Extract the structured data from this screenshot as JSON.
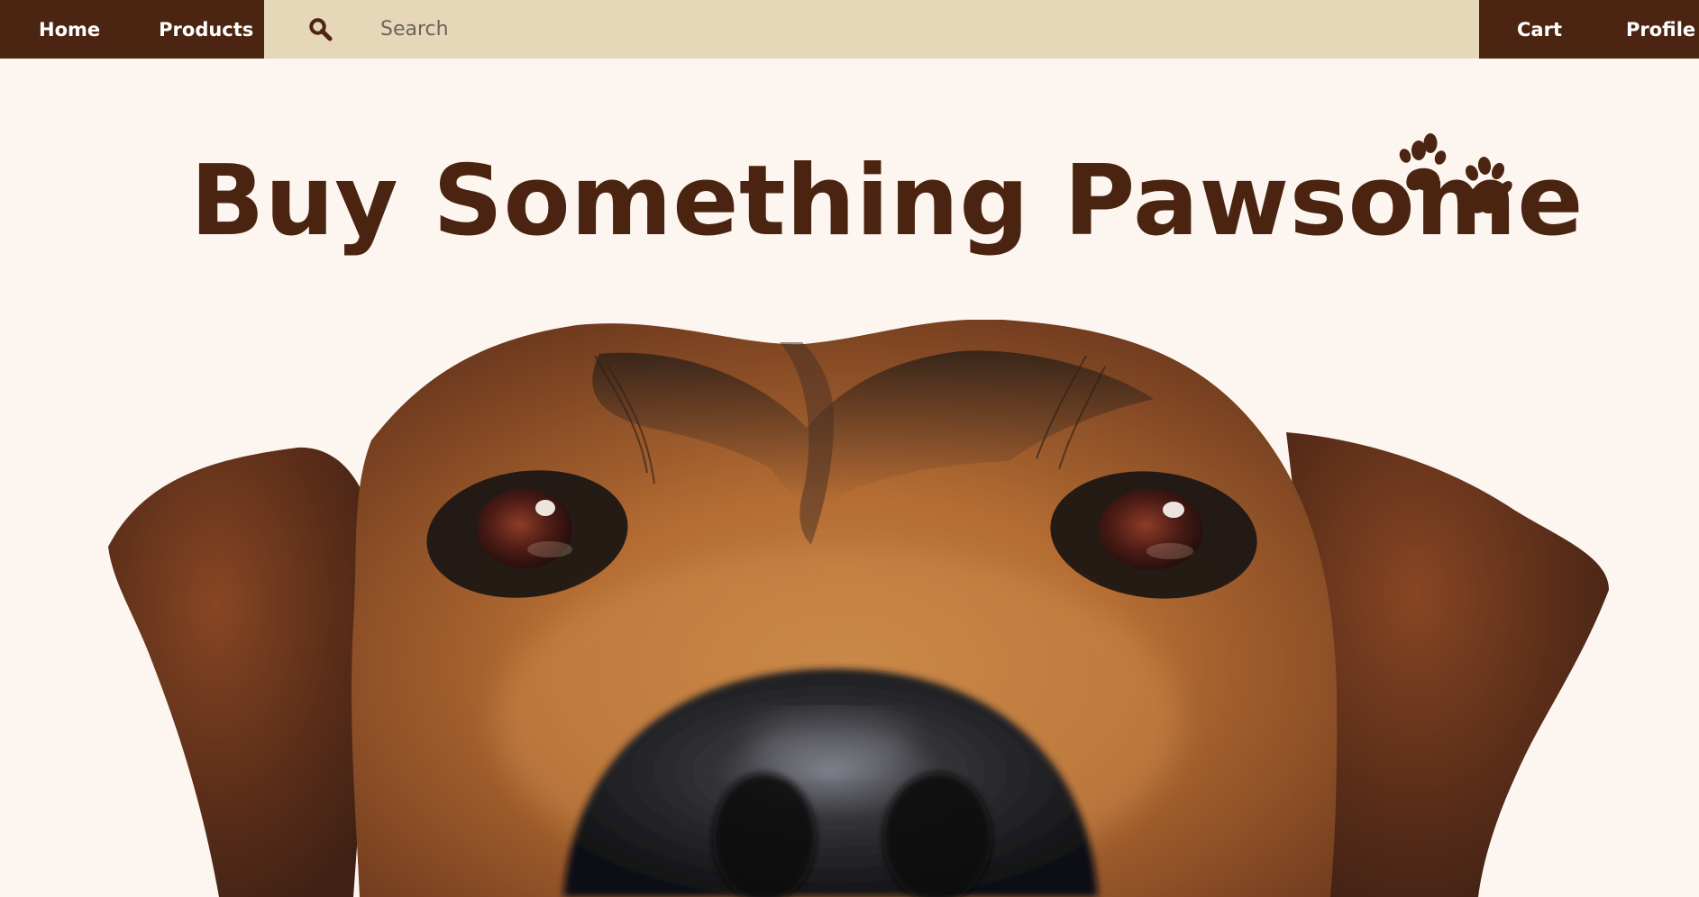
{
  "nav": {
    "left_links": [
      "Home",
      "Products"
    ],
    "right_links": [
      "Cart",
      "Profile"
    ],
    "search": {
      "icon": "search-icon",
      "placeholder": "Search"
    }
  },
  "hero": {
    "title": "Buy Something Pawsome",
    "decoration_icon": "paw-prints-icon"
  },
  "image": {
    "subject": "dog-face-image"
  },
  "colors": {
    "brand_dark_brown": "#4b2511",
    "nav_beige": "#e6d7b9",
    "page_background": "#fdf6f0",
    "title_brown": "#4a2410"
  }
}
